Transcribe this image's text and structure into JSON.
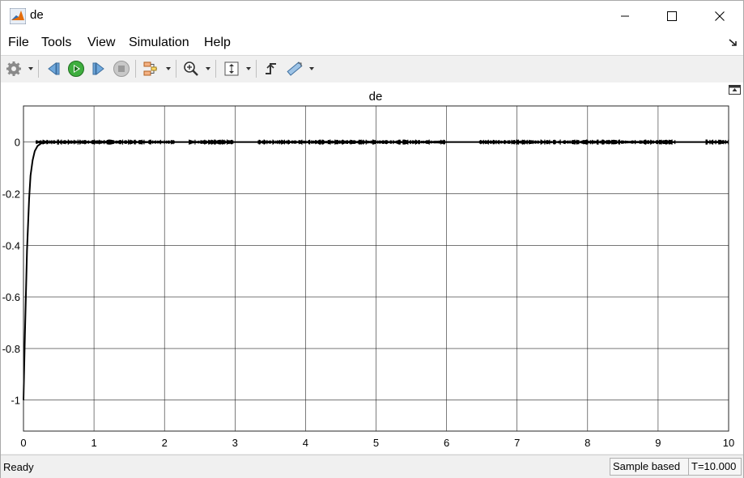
{
  "window": {
    "title": "de",
    "icon": "matlab-logo-icon"
  },
  "menu": [
    "File",
    "Tools",
    "View",
    "Simulation",
    "Help"
  ],
  "toolbar": {
    "buttons": [
      "configuration-properties-icon",
      "step-back-icon",
      "run-icon",
      "step-forward-icon",
      "stop-icon",
      "signal-selector-icon",
      "zoom-in-icon",
      "autoscale-icon",
      "triggers-icon",
      "cursor-measurements-icon"
    ]
  },
  "status": {
    "ready": "Ready",
    "sample": "Sample based",
    "time": "T=10.000"
  },
  "colors": {
    "line": "#000000",
    "grid": "#262626",
    "window": "#f0f0f0",
    "accent_run": "#2e9a2e"
  },
  "chart_data": {
    "type": "line",
    "title": "de",
    "xlim": [
      0,
      10
    ],
    "ylim": [
      -1.12,
      0.14
    ],
    "xticks": [
      "0",
      "1",
      "2",
      "3",
      "4",
      "5",
      "6",
      "7",
      "8",
      "9",
      "10"
    ],
    "yticks": [
      {
        "v": 0,
        "label": "0"
      },
      {
        "v": -0.2,
        "label": "-0.2"
      },
      {
        "v": -0.4,
        "label": "-0.4"
      },
      {
        "v": -0.6,
        "label": "-0.6"
      },
      {
        "v": -0.8,
        "label": "-0.8"
      },
      {
        "v": -1,
        "label": "-1"
      }
    ],
    "grid": true,
    "series": [
      {
        "x": [
          0,
          0.02,
          0.05,
          0.08,
          0.1,
          0.13,
          0.16,
          0.2,
          0.25,
          0.3,
          0.5,
          1,
          2,
          3,
          4,
          5,
          6,
          7,
          8,
          9,
          10
        ],
        "y": [
          -1,
          -0.75,
          -0.42,
          -0.22,
          -0.13,
          -0.07,
          -0.035,
          -0.015,
          -0.005,
          0,
          0,
          0,
          0,
          0,
          0,
          0,
          0,
          0,
          0,
          0,
          0
        ]
      }
    ],
    "noise_segments": [
      [
        0.18,
        2.15
      ],
      [
        2.35,
        2.98
      ],
      [
        3.33,
        5.98
      ],
      [
        6.47,
        9.25
      ],
      [
        9.68,
        10
      ]
    ],
    "noise_amplitude": 0.01
  }
}
